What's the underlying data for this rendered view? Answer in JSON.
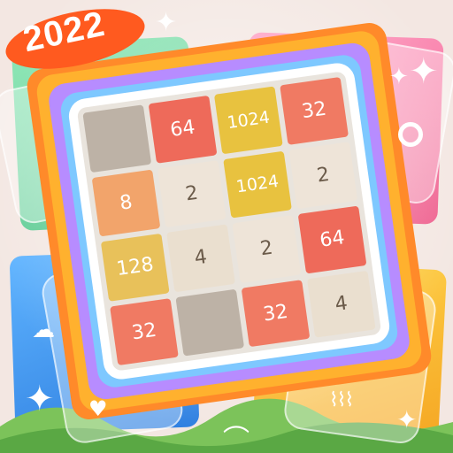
{
  "year_badge": {
    "text": "2022",
    "color": "#ff5a1f"
  },
  "board": {
    "colors": {
      "empty": "#bdb2a6",
      "2": "#eee4d8",
      "4": "#eadfcf",
      "8": "#f2a46b",
      "32": "#f07a63",
      "64": "#ee6a5a",
      "128": "#e8c15a",
      "1024": "#e8c23f"
    },
    "rows": [
      [
        "",
        "64",
        "1024",
        "32"
      ],
      [
        "",
        "",
        "1024",
        "2"
      ],
      [
        "8",
        "2",
        "",
        "64"
      ],
      [
        "128",
        "4",
        "2",
        ""
      ]
    ],
    "extra_row": [
      "32",
      "",
      "32",
      "4"
    ]
  },
  "tile_labels": {
    "t64a": "64",
    "t1024a": "1024",
    "t32a": "32",
    "t2a": "2",
    "t1024b": "1024",
    "t2b": "2",
    "t8": "8",
    "t2c": "2",
    "t64b": "64",
    "t128": "128",
    "t4a": "4",
    "t2d": "2",
    "t32b": "32",
    "t32c": "32",
    "t4b": "4"
  }
}
